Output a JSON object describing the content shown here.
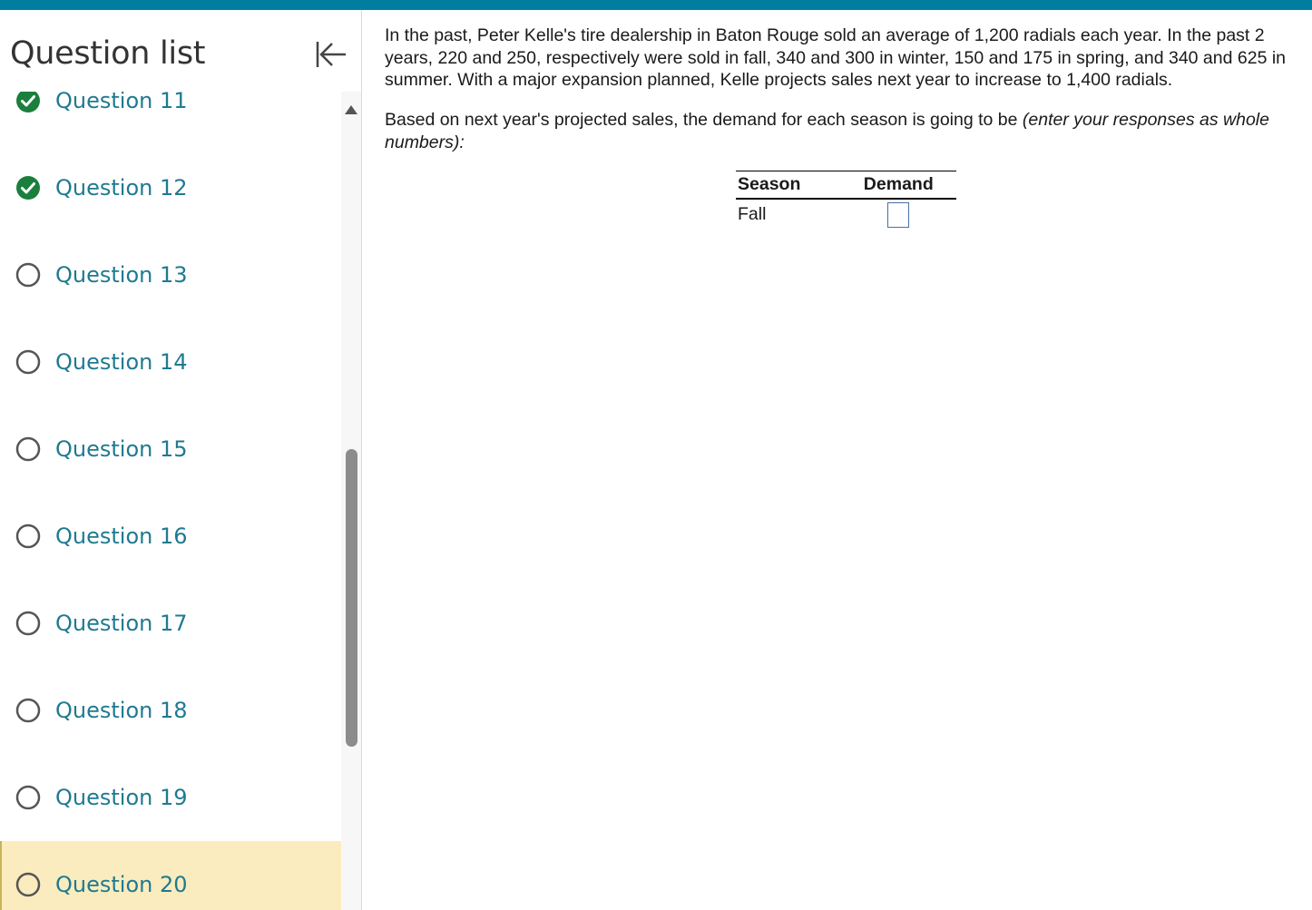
{
  "sidebar": {
    "title": "Question list",
    "items": [
      {
        "label": "Question 11",
        "status": "done"
      },
      {
        "label": "Question 12",
        "status": "done"
      },
      {
        "label": "Question 13",
        "status": "todo"
      },
      {
        "label": "Question 14",
        "status": "todo"
      },
      {
        "label": "Question 15",
        "status": "todo"
      },
      {
        "label": "Question 16",
        "status": "todo"
      },
      {
        "label": "Question 17",
        "status": "todo"
      },
      {
        "label": "Question 18",
        "status": "todo"
      },
      {
        "label": "Question 19",
        "status": "todo"
      },
      {
        "label": "Question 20",
        "status": "current"
      }
    ]
  },
  "question": {
    "paragraph1": "In the past, Peter Kelle's tire dealership in Baton Rouge sold an average of 1,200 radials each year. In the past 2 years, 220 and 250, respectively were sold in fall, 340 and 300 in winter, 150 and 175 in spring, and 340 and 625 in summer. With a major expansion planned, Kelle projects sales next year to increase to 1,400 radials.",
    "paragraph2_plain": "Based on next year's projected sales, the demand for each season is going to be ",
    "paragraph2_italic": "(enter your responses as whole numbers):",
    "table": {
      "headers": [
        "Season",
        "Demand"
      ],
      "rows": [
        {
          "season": "Fall",
          "demand": ""
        }
      ]
    }
  },
  "colors": {
    "accent": "#007d9f",
    "link": "#1f7a91",
    "done": "#1a7f3c",
    "current_bg": "#faecbe"
  }
}
